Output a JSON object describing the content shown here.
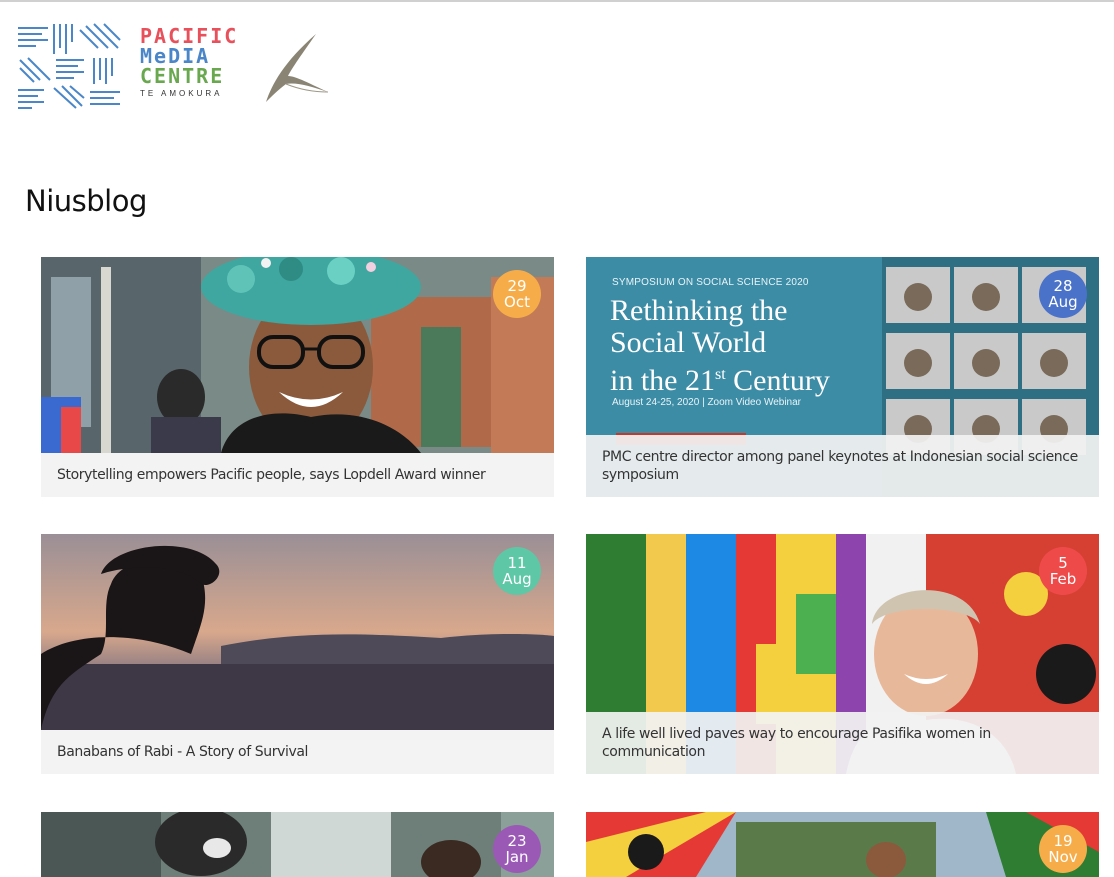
{
  "brand": {
    "line1": "PACIFIC",
    "line2": "MeDIA",
    "line3": "CENTRE",
    "sub": "TE AMOKURA",
    "colors": {
      "line1": "#e8505b",
      "line2": "#4a86c8",
      "line3": "#6aa84f"
    }
  },
  "page": {
    "title": "Niusblog"
  },
  "posts": [
    {
      "title": "Storytelling empowers Pacific people, says Lopdell Award winner",
      "day": "29",
      "month": "Oct",
      "badge_color": "#f6ad49",
      "image": "portrait-with-flower-crown"
    },
    {
      "title": "PMC centre director among panel keynotes at Indonesian social science symposium",
      "day": "28",
      "month": "Aug",
      "badge_color": "#4a72c8",
      "image": "symposium-banner",
      "banner": {
        "kicker": "SYMPOSIUM ON SOCIAL SCIENCE 2020",
        "line1": "Rethinking the",
        "line2": "Social World",
        "line3": "in the 21",
        "sup": "st",
        "line3b": " Century",
        "date": "August 24-25, 2020 | Zoom Video Webinar"
      }
    },
    {
      "title": "Banabans of Rabi - A Story of Survival",
      "day": "11",
      "month": "Aug",
      "badge_color": "#5ec7a6",
      "image": "silhouette-at-sunset"
    },
    {
      "title": "A life well lived paves way to encourage Pasifika women in communication",
      "day": "5",
      "month": "Feb",
      "badge_color": "#ef4a4a",
      "image": "woman-with-flags"
    },
    {
      "title": "",
      "day": "23",
      "month": "Jan",
      "badge_color": "#9b59b6",
      "image": "gorilla-figure"
    },
    {
      "title": "",
      "day": "19",
      "month": "Nov",
      "badge_color": "#f6ad49",
      "image": "flags-in-street"
    }
  ]
}
